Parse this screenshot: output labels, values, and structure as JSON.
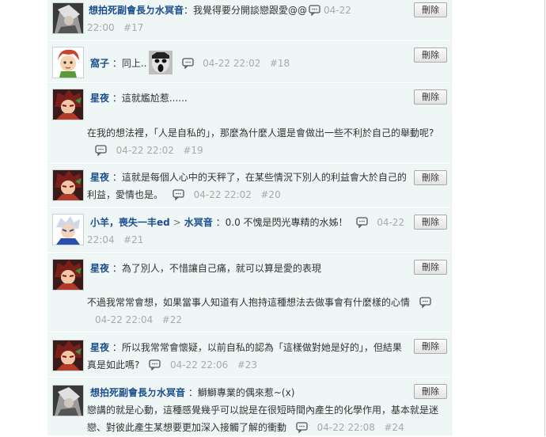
{
  "delete_label": "刪除",
  "sep_colon": "：",
  "reply_arrow": ">",
  "comments": [
    {
      "user": "想拍死副會長ㄉ水冥音",
      "text": "我覺得要分開談戀跟愛@@",
      "date": "04-22 22:00",
      "floor": "#17"
    },
    {
      "user": "窩子",
      "text": "同上..",
      "date": "04-22 22:02",
      "floor": "#18"
    },
    {
      "user": "星夜",
      "text": "這就尷尬惹......",
      "text2": "在我的想法裡，「人是自私的」，那麼為什麼人還是會做出一些不利於自己的舉動呢?",
      "date": "04-22 22:02",
      "floor": "#19"
    },
    {
      "user": "星夜",
      "text": "這就是每個人心中的天秤了，在某些情況下別人的利益會大於自己的",
      "text2": "利益，愛情也是。",
      "date": "04-22 22:02",
      "floor": "#20"
    },
    {
      "user": "小羊，喪失一丰ed",
      "reply_to": "水冥音",
      "text": "0.0 不愧是閃光專精的水姊！",
      "date": "04-22 22:04",
      "floor": "#21"
    },
    {
      "user": "星夜",
      "text": "為了別人，不惜讓自己痛，就可以算是愛的表現",
      "text2": "不過我常常會想，如果當事人知道有人抱持這種想法去做事會有什麼樣的心情",
      "date": "04-22 22:04",
      "floor": "#22"
    },
    {
      "user": "星夜",
      "text": "所以我常常會懷疑，以前自私的認為「這樣做對她是好的」，但結果",
      "text2": "真是如此嗎?",
      "date": "04-22 22:06",
      "floor": "#23"
    },
    {
      "user": "想拍死副會長ㄉ水冥音",
      "text": "鰤鰤專業的偶來惹~(x)",
      "text2": "戀講的就是心動，這種感覺幾乎可以說是在很短時間內產生的化學作用，基本就是迷",
      "text3": "戀、對彼此產生某想要更加深入接觸了解的衝動",
      "date": "04-22 22:08",
      "floor": "#24"
    }
  ]
}
